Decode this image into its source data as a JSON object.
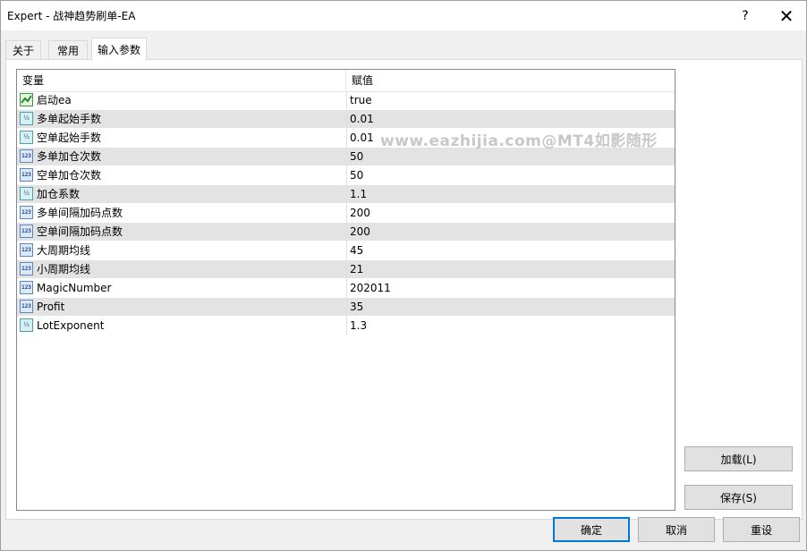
{
  "window": {
    "title": "Expert - 战神趋势刷单-EA",
    "help_glyph": "?",
    "close_glyph": "✕"
  },
  "tabs": [
    {
      "label": "关于"
    },
    {
      "label": "常用"
    },
    {
      "label": "输入参数"
    }
  ],
  "grid": {
    "headers": {
      "variable": "变量",
      "value": "赋值"
    },
    "rows": [
      {
        "name": "启动ea",
        "value": "true",
        "icon": "bool-icon"
      },
      {
        "name": "多单起始手数",
        "value": "0.01",
        "icon": "fraction-icon"
      },
      {
        "name": "空单起始手数",
        "value": "0.01",
        "icon": "fraction-icon"
      },
      {
        "name": "多单加仓次数",
        "value": "50",
        "icon": "integer-icon"
      },
      {
        "name": "空单加仓次数",
        "value": "50",
        "icon": "integer-icon"
      },
      {
        "name": "加仓系数",
        "value": "1.1",
        "icon": "fraction-icon"
      },
      {
        "name": "多单间隔加码点数",
        "value": "200",
        "icon": "integer-icon"
      },
      {
        "name": "空单间隔加码点数",
        "value": "200",
        "icon": "integer-icon"
      },
      {
        "name": "大周期均线",
        "value": "45",
        "icon": "integer-icon"
      },
      {
        "name": "小周期均线",
        "value": "21",
        "icon": "integer-icon"
      },
      {
        "name": "MagicNumber",
        "value": "202011",
        "icon": "integer-icon"
      },
      {
        "name": "Profit",
        "value": "35",
        "icon": "integer-icon"
      },
      {
        "name": "LotExponent",
        "value": "1.3",
        "icon": "fraction-icon"
      }
    ]
  },
  "watermark": "www.eazhijia.com@MT4如影随形",
  "side_buttons": {
    "load": "加载(L)",
    "save": "保存(S)"
  },
  "footer_buttons": {
    "ok": "确定",
    "cancel": "取消",
    "reset": "重设"
  }
}
